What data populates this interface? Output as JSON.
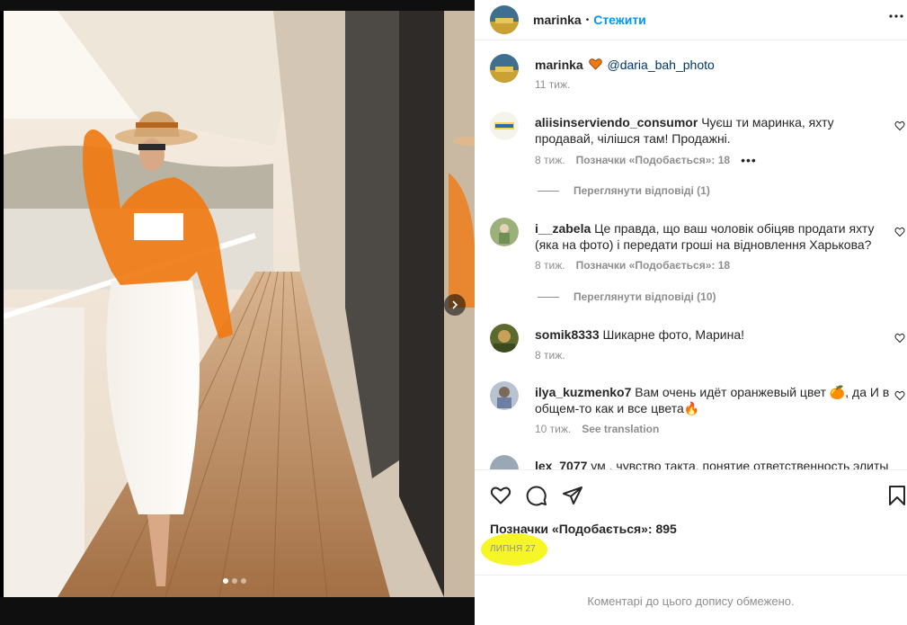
{
  "post": {
    "author": "marinka",
    "follow_label": "Стежити",
    "separator": "•",
    "caption_mention": "@daria_bah_photo",
    "caption_time": "11 тиж.",
    "likes_text": "Позначки «Подобається»: 895",
    "date": "ЛИПНЯ 27",
    "restricted_text": "Коментарі до цього допису обмежено.",
    "carousel_dots": 3,
    "carousel_active_index": 0
  },
  "comments": [
    {
      "username": "aliisinserviendo_consumor",
      "text": "Чуєш ти маринка, яхту продавай, чілішся там! Продажні.",
      "time": "8 тиж.",
      "likes": "Позначки «Подобається»: 18",
      "more": "•••",
      "replies": "Переглянути відповіді (1)"
    },
    {
      "username": "i__zabela",
      "text": "Це правда, що ваш чоловік обіцяв продати яхту (яка на фото) і передати гроші на відновлення Харькова?",
      "time": "8 тиж.",
      "likes": "Позначки «Подобається»: 18",
      "replies": "Переглянути відповіді (10)"
    },
    {
      "username": "somik8333",
      "text": "Шикарне фото, Марина!",
      "time": "8 тиж."
    },
    {
      "username": "ilya_kuzmenko7",
      "text": "Вам очень идёт оранжевый цвет 🍊, да И в общем-то как и все цвета🔥",
      "time": "10 тиж.",
      "translate": "See translation"
    },
    {
      "username": "lex_7077",
      "text": "ум , чувство такта, понятие ответственность элиты"
    }
  ],
  "colors": {
    "accent": "#0095f6",
    "text": "#262626",
    "muted": "#8e8e8e",
    "highlight": "#f5f500",
    "shirt": "#f07a12"
  },
  "icons": {
    "header_more": "more-horizontal-icon",
    "like": "heart-icon",
    "comment": "comment-icon",
    "share": "send-icon",
    "save": "bookmark-icon",
    "next": "chevron-right-icon"
  }
}
